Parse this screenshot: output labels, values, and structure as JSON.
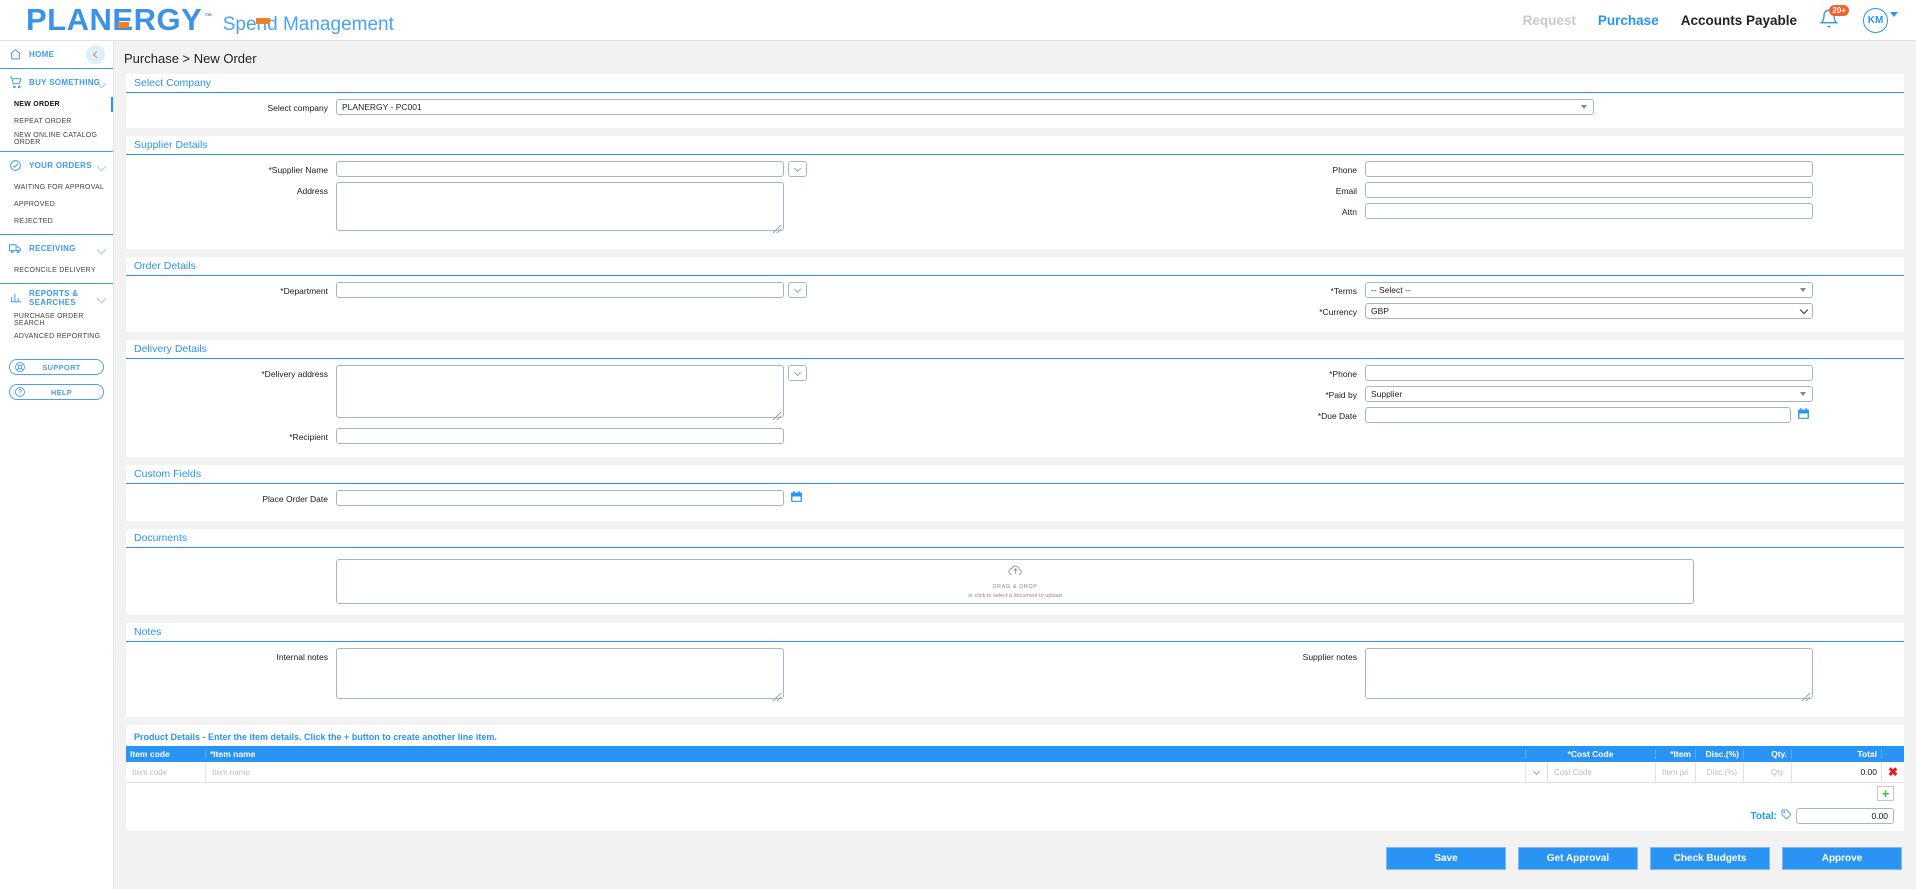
{
  "brand": {
    "name": "PLANERGY",
    "tm": "™",
    "tagline": "Spend Management",
    "accent_blue": "#2a94f4",
    "accent_orange": "#f0802a"
  },
  "topnav": {
    "request": "Request",
    "purchase": "Purchase",
    "accounts_payable": "Accounts Payable",
    "notification_count": "20+",
    "avatar_initials": "KM"
  },
  "sidebar": {
    "home": "HOME",
    "groups": [
      {
        "label": "BUY SOMETHING",
        "icon": "cart-icon",
        "items": [
          "NEW ORDER",
          "REPEAT ORDER",
          "NEW ONLINE CATALOG ORDER"
        ],
        "active": "NEW ORDER"
      },
      {
        "label": "YOUR ORDERS",
        "icon": "check-circle-icon",
        "items": [
          "WAITING FOR APPROVAL",
          "APPROVED",
          "REJECTED"
        ],
        "active": ""
      },
      {
        "label": "RECEIVING",
        "icon": "truck-icon",
        "items": [
          "RECONCILE DELIVERY"
        ],
        "active": ""
      },
      {
        "label": "REPORTS & SEARCHES",
        "icon": "bar-chart-icon",
        "items": [
          "PURCHASE ORDER SEARCH",
          "ADVANCED REPORTING"
        ],
        "active": ""
      }
    ],
    "support": "SUPPORT",
    "help": "HELP"
  },
  "page": {
    "breadcrumb": "Purchase > New Order"
  },
  "select_company": {
    "section_title": "Select Company",
    "label": "Select company",
    "value": "PLANERGY - PC001"
  },
  "supplier_details": {
    "section_title": "Supplier Details",
    "supplier_name_label": "*Supplier Name",
    "supplier_name_value": "",
    "address_label": "Address",
    "address_value": "",
    "phone_label": "Phone",
    "phone_value": "",
    "email_label": "Email",
    "email_value": "",
    "attn_label": "Attn",
    "attn_value": ""
  },
  "order_details": {
    "section_title": "Order Details",
    "department_label": "*Department",
    "department_value": "",
    "terms_label": "*Terms",
    "terms_value": "-- Select --",
    "currency_label": "*Currency",
    "currency_value": "GBP"
  },
  "delivery_details": {
    "section_title": "Delivery Details",
    "delivery_address_label": "*Delivery address",
    "delivery_address_value": "",
    "recipient_label": "*Recipient",
    "recipient_value": "",
    "phone_label": "*Phone",
    "phone_value": "",
    "paid_by_label": "*Paid by",
    "paid_by_value": "Supplier",
    "due_date_label": "*Due Date",
    "due_date_value": ""
  },
  "custom_fields": {
    "section_title": "Custom Fields",
    "place_order_date_label": "Place Order Date",
    "place_order_date_value": ""
  },
  "documents": {
    "section_title": "Documents",
    "drag_drop": "DRAG & DROP",
    "click_hint": "or click to select a document to upload"
  },
  "notes": {
    "section_title": "Notes",
    "internal_notes_label": "Internal notes",
    "internal_notes_value": "",
    "supplier_notes_label": "Supplier notes",
    "supplier_notes_value": ""
  },
  "product_details": {
    "title": "Product Details - Enter the item details. Click the + button to create another line item.",
    "columns": {
      "item_code": "Item code",
      "item_name": "*Item name",
      "cost_code": "*Cost Code",
      "item_price": "*Item",
      "discount": "Disc.(%)",
      "qty": "Qty.",
      "total": "Total"
    },
    "rows": [
      {
        "item_code": "",
        "item_code_placeholder": "Item code",
        "item_name": "",
        "item_name_placeholder": "Item name",
        "cost_code": "",
        "cost_code_placeholder": "Cost Code",
        "item_price": "",
        "item_price_placeholder": "Item price",
        "discount": "",
        "discount_placeholder": "Disc.(%)",
        "qty": "",
        "qty_placeholder": "Qty.",
        "total": "0.00"
      }
    ],
    "add_row_label": "+",
    "total_label": "Total:",
    "total_value": "0.00"
  },
  "footer": {
    "save": "Save",
    "get_approval": "Get Approval",
    "check_budgets": "Check Budgets",
    "approve": "Approve"
  }
}
